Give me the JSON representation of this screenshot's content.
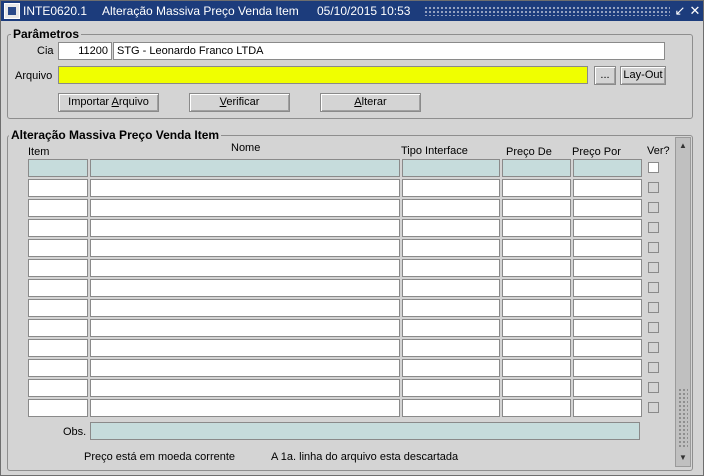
{
  "window": {
    "code": "INTE0620.1",
    "title": "Alteração Massiva Preço Venda Item",
    "datetime": "05/10/2015 10:53"
  },
  "params": {
    "title": "Parâmetros",
    "cia_label": "Cia",
    "cia_code": "11200",
    "cia_name": "STG - Leonardo Franco LTDA",
    "arquivo_label": "Arquivo",
    "arquivo_value": "",
    "browse_label": "...",
    "layout_label": "Lay-Out",
    "importar_label": "Importar ",
    "importar_u": "A",
    "importar_rest": "rquivo",
    "verificar_u": "V",
    "verificar_rest": "erificar",
    "alterar_u": "A",
    "alterar_rest": "lterar"
  },
  "grid": {
    "title": "Alteração Massiva Preço Venda Item",
    "columns": {
      "item": "Item",
      "nome": "Nome",
      "tipo_interface": "Tipo Interface",
      "preco_de": "Preço De",
      "preco_por": "Preço Por",
      "ver": "Ver?"
    },
    "row_count": 13,
    "obs_label": "Obs.",
    "obs_value": "",
    "footer_left": "Preço está em moeda corrente",
    "footer_right": "A 1a. linha do arquivo esta descartada"
  }
}
